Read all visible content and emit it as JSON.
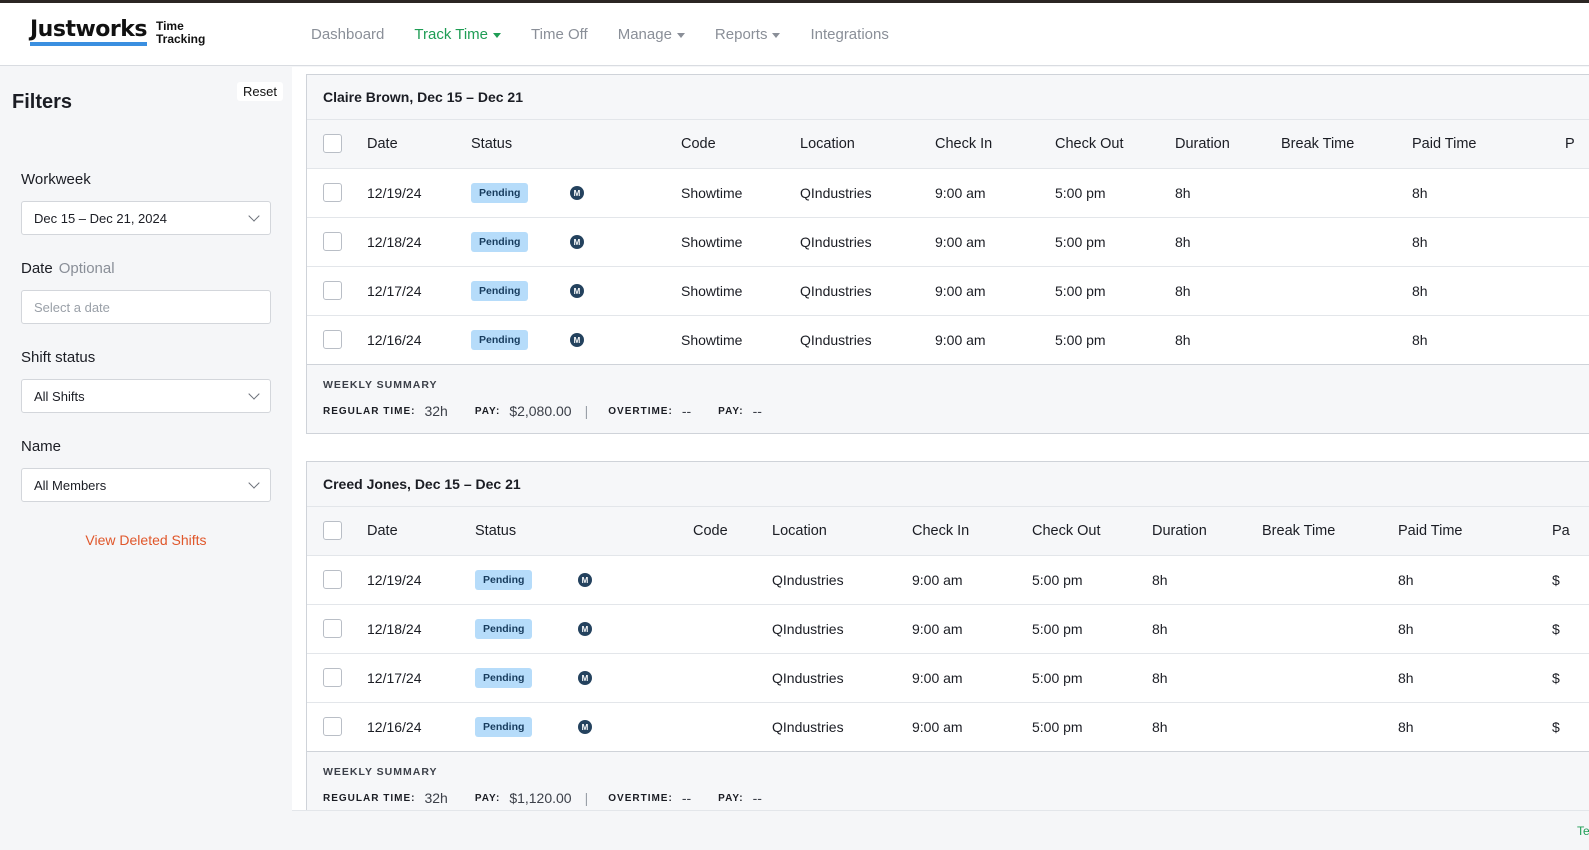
{
  "app": {
    "logo_word": "Justworks",
    "logo_sub_1": "Time",
    "logo_sub_2": "Tracking"
  },
  "nav": {
    "items": [
      {
        "label": "Dashboard",
        "dropdown": false,
        "active": false
      },
      {
        "label": "Track Time",
        "dropdown": true,
        "active": true
      },
      {
        "label": "Time Off",
        "dropdown": false,
        "active": false
      },
      {
        "label": "Manage",
        "dropdown": true,
        "active": false
      },
      {
        "label": "Reports",
        "dropdown": true,
        "active": false
      },
      {
        "label": "Integrations",
        "dropdown": false,
        "active": false
      }
    ]
  },
  "filters": {
    "title": "Filters",
    "reset_label": "Reset",
    "workweek_label": "Workweek",
    "workweek_value": "Dec 15 – Dec 21, 2024",
    "date_label": "Date",
    "date_optional": "Optional",
    "date_placeholder": "Select a date",
    "shift_status_label": "Shift status",
    "shift_status_value": "All Shifts",
    "name_label": "Name",
    "name_value": "All Members",
    "deleted_link": "View Deleted Shifts"
  },
  "columns": [
    "Date",
    "Status",
    "Code",
    "Location",
    "Check In",
    "Check Out",
    "Duration",
    "Break Time",
    "Paid Time"
  ],
  "cards": [
    {
      "title": "Claire Brown, Dec 15 – Dec 21",
      "extra_col_glyph": "P",
      "rows": [
        {
          "date": "12/19/24",
          "status": "Pending",
          "mark": "M",
          "code": "Showtime",
          "location": "QIndustries",
          "check_in": "9:00 am",
          "check_out": "5:00 pm",
          "duration": "8h",
          "break_time": "",
          "paid_time": "8h",
          "extra": ""
        },
        {
          "date": "12/18/24",
          "status": "Pending",
          "mark": "M",
          "code": "Showtime",
          "location": "QIndustries",
          "check_in": "9:00 am",
          "check_out": "5:00 pm",
          "duration": "8h",
          "break_time": "",
          "paid_time": "8h",
          "extra": ""
        },
        {
          "date": "12/17/24",
          "status": "Pending",
          "mark": "M",
          "code": "Showtime",
          "location": "QIndustries",
          "check_in": "9:00 am",
          "check_out": "5:00 pm",
          "duration": "8h",
          "break_time": "",
          "paid_time": "8h",
          "extra": ""
        },
        {
          "date": "12/16/24",
          "status": "Pending",
          "mark": "M",
          "code": "Showtime",
          "location": "QIndustries",
          "check_in": "9:00 am",
          "check_out": "5:00 pm",
          "duration": "8h",
          "break_time": "",
          "paid_time": "8h",
          "extra": ""
        }
      ],
      "summary": {
        "title": "WEEKLY SUMMARY",
        "regular_key": "REGULAR TIME:",
        "regular_val": "32h",
        "pay_key": "PAY:",
        "pay_val": "$2,080.00",
        "sep": "|",
        "overtime_key": "OVERTIME:",
        "overtime_val": "--",
        "pay2_key": "PAY:",
        "pay2_val": "--"
      }
    },
    {
      "title": "Creed Jones, Dec 15 – Dec 21",
      "extra_col_glyph": "Pa",
      "rows": [
        {
          "date": "12/19/24",
          "status": "Pending",
          "mark": "M",
          "code": "",
          "location": "QIndustries",
          "check_in": "9:00 am",
          "check_out": "5:00 pm",
          "duration": "8h",
          "break_time": "",
          "paid_time": "8h",
          "extra": "$"
        },
        {
          "date": "12/18/24",
          "status": "Pending",
          "mark": "M",
          "code": "",
          "location": "QIndustries",
          "check_in": "9:00 am",
          "check_out": "5:00 pm",
          "duration": "8h",
          "break_time": "",
          "paid_time": "8h",
          "extra": "$"
        },
        {
          "date": "12/17/24",
          "status": "Pending",
          "mark": "M",
          "code": "",
          "location": "QIndustries",
          "check_in": "9:00 am",
          "check_out": "5:00 pm",
          "duration": "8h",
          "break_time": "",
          "paid_time": "8h",
          "extra": "$"
        },
        {
          "date": "12/16/24",
          "status": "Pending",
          "mark": "M",
          "code": "",
          "location": "QIndustries",
          "check_in": "9:00 am",
          "check_out": "5:00 pm",
          "duration": "8h",
          "break_time": "",
          "paid_time": "8h",
          "extra": "$"
        }
      ],
      "summary": {
        "title": "WEEKLY SUMMARY",
        "regular_key": "REGULAR TIME:",
        "regular_val": "32h",
        "pay_key": "PAY:",
        "pay_val": "$1,120.00",
        "sep": "|",
        "overtime_key": "OVERTIME:",
        "overtime_val": "--",
        "pay2_key": "PAY:",
        "pay2_val": "--"
      }
    }
  ],
  "footer": {
    "text": "Te"
  },
  "colors": {
    "accent_green": "#1f9d55",
    "link_orange": "#e0572b",
    "badge_bg": "#b6dcfa",
    "logo_underline": "#3a8fe0"
  }
}
